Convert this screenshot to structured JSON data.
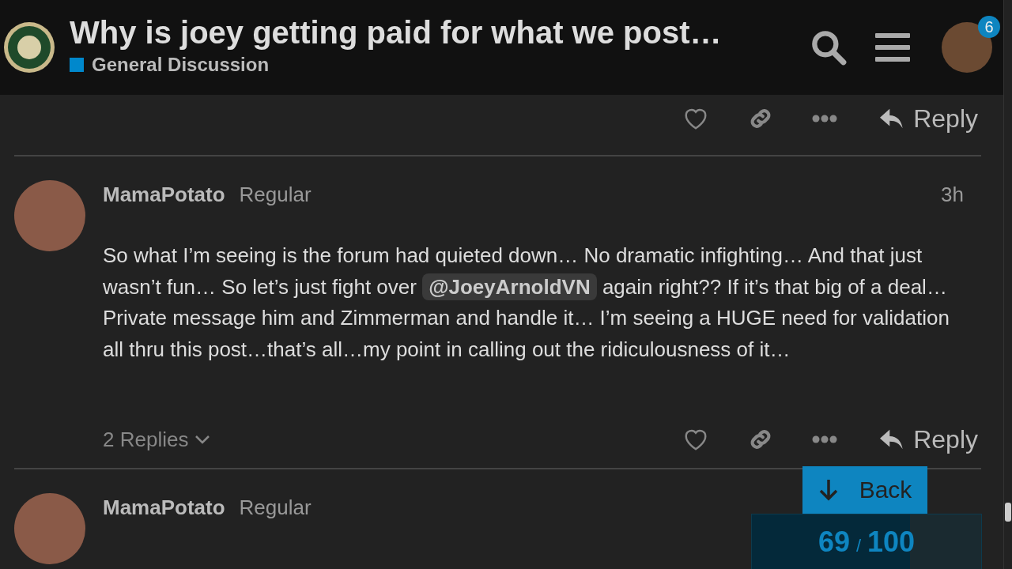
{
  "header": {
    "title": "Why is joey getting paid for what we post…",
    "category": {
      "label": "General Discussion",
      "color": "#0088cc"
    },
    "notifications": "6"
  },
  "previous_post_actions": {
    "reply": "Reply"
  },
  "posts": [
    {
      "username": "MamaPotato",
      "title": "Regular",
      "time": "3h",
      "body": [
        {
          "kind": "text",
          "text": "So what I’m seeing is the forum had quieted down… No dramatic infighting… And that just wasn’t fun… So let’s just fight over "
        },
        {
          "kind": "mention",
          "text": "@JoeyArnoldVN"
        },
        {
          "kind": "text",
          "text": " again right?? If it’s that big of a deal… Private message him and Zimmerman and handle it… I’m seeing a HUGE need for validation all thru this post…that’s all…my point in calling out the ridiculousness of it…"
        }
      ],
      "replies": "2 Replies",
      "reply": "Reply"
    },
    {
      "username": "MamaPotato",
      "title": "Regular"
    }
  ],
  "back_button": "Back",
  "progress": {
    "current": "69",
    "separator": "/",
    "total": "100",
    "level": 0.69
  }
}
